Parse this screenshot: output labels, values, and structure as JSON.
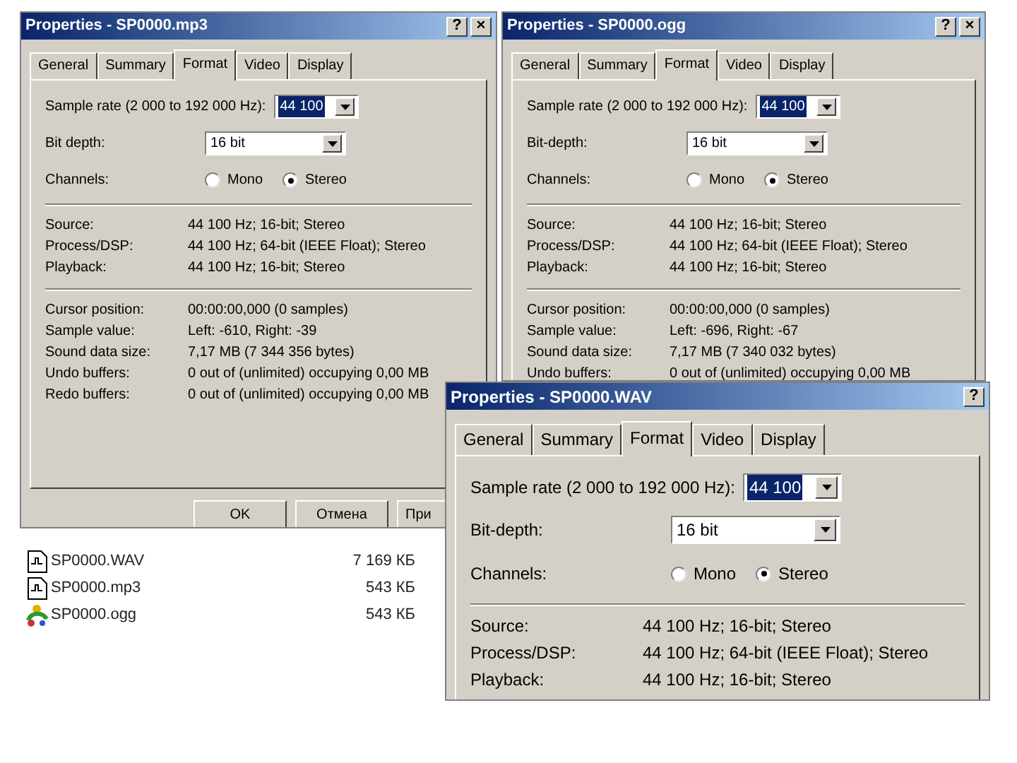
{
  "windows": [
    {
      "title": "Properties - SP0000.mp3",
      "title_buttons": [
        "?",
        "×"
      ],
      "tabs": [
        {
          "label": "General",
          "selected": false
        },
        {
          "label": "Summary",
          "selected": false
        },
        {
          "label": "Format",
          "selected": true
        },
        {
          "label": "Video",
          "selected": false
        },
        {
          "label": "Display",
          "selected": false
        }
      ],
      "sample_rate": {
        "label": "Sample rate (2 000 to 192 000 Hz):",
        "value": "44 100",
        "highlighted": true
      },
      "bit_depth": {
        "label": "Bit depth:",
        "value": "16 bit",
        "highlighted": false
      },
      "channels": {
        "label": "Channels:",
        "options": [
          {
            "label": "Mono",
            "selected": false
          },
          {
            "label": "Stereo",
            "selected": true
          }
        ]
      },
      "format_rows": [
        {
          "label": "Source:",
          "value": "44 100 Hz; 16-bit; Stereo"
        },
        {
          "label": "Process/DSP:",
          "value": "44 100 Hz; 64-bit (IEEE Float); Stereo"
        },
        {
          "label": "Playback:",
          "value": "44 100 Hz; 16-bit; Stereo"
        }
      ],
      "status_rows": [
        {
          "label": "Cursor position:",
          "value": "00:00:00,000  (0 samples)"
        },
        {
          "label": "Sample value:",
          "value": "Left: -610, Right: -39"
        },
        {
          "label": "Sound data size:",
          "value": "7,17 MB (7 344 356 bytes)"
        },
        {
          "label": "Undo buffers:",
          "value": "0 out of (unlimited) occupying 0,00 MB"
        },
        {
          "label": "Redo buffers:",
          "value": "0 out of (unlimited) occupying 0,00 MB"
        }
      ],
      "buttons": [
        "OK",
        "Отмена",
        "При"
      ]
    },
    {
      "title": "Properties - SP0000.ogg",
      "title_buttons": [
        "?",
        "×"
      ],
      "tabs": [
        {
          "label": "General",
          "selected": false
        },
        {
          "label": "Summary",
          "selected": false
        },
        {
          "label": "Format",
          "selected": true
        },
        {
          "label": "Video",
          "selected": false
        },
        {
          "label": "Display",
          "selected": false
        }
      ],
      "sample_rate": {
        "label": "Sample rate (2 000 to 192 000 Hz):",
        "value": "44 100",
        "highlighted": true
      },
      "bit_depth": {
        "label": "Bit-depth:",
        "value": "16 bit",
        "highlighted": false
      },
      "channels": {
        "label": "Channels:",
        "options": [
          {
            "label": "Mono",
            "selected": false
          },
          {
            "label": "Stereo",
            "selected": true
          }
        ]
      },
      "format_rows": [
        {
          "label": "Source:",
          "value": "44 100 Hz; 16-bit; Stereo"
        },
        {
          "label": "Process/DSP:",
          "value": "44 100 Hz; 64-bit (IEEE Float); Stereo"
        },
        {
          "label": "Playback:",
          "value": "44 100 Hz; 16-bit; Stereo"
        }
      ],
      "status_rows": [
        {
          "label": "Cursor position:",
          "value": "00:00:00,000  (0 samples)"
        },
        {
          "label": "Sample value:",
          "value": "Left: -696, Right: -67"
        },
        {
          "label": "Sound data size:",
          "value": "7,17 MB (7 340 032 bytes)"
        },
        {
          "label": "Undo buffers:",
          "value": "0 out of (unlimited) occupying 0,00 MB"
        }
      ]
    },
    {
      "title": "Properties - SP0000.WAV",
      "title_buttons": [
        "?"
      ],
      "tabs": [
        {
          "label": "General",
          "selected": false
        },
        {
          "label": "Summary",
          "selected": false
        },
        {
          "label": "Format",
          "selected": true
        },
        {
          "label": "Video",
          "selected": false
        },
        {
          "label": "Display",
          "selected": false
        }
      ],
      "sample_rate": {
        "label": "Sample rate (2 000 to 192 000 Hz):",
        "value": "44 100",
        "highlighted": true
      },
      "bit_depth": {
        "label": "Bit-depth:",
        "value": "16 bit",
        "highlighted": false
      },
      "channels": {
        "label": "Channels:",
        "options": [
          {
            "label": "Mono",
            "selected": false
          },
          {
            "label": "Stereo",
            "selected": true
          }
        ]
      },
      "format_rows": [
        {
          "label": "Source:",
          "value": "44 100 Hz; 16-bit; Stereo"
        },
        {
          "label": "Process/DSP:",
          "value": "44 100 Hz; 64-bit (IEEE Float); Stereo"
        },
        {
          "label": "Playback:",
          "value": "44 100 Hz; 16-bit; Stereo"
        }
      ]
    }
  ],
  "files": [
    {
      "kind": "wave",
      "name": "SP0000.WAV",
      "size": "7 169 КБ"
    },
    {
      "kind": "wave",
      "name": "SP0000.mp3",
      "size": "543 КБ"
    },
    {
      "kind": "ogg",
      "name": "SP0000.ogg",
      "size": "543 КБ"
    }
  ]
}
